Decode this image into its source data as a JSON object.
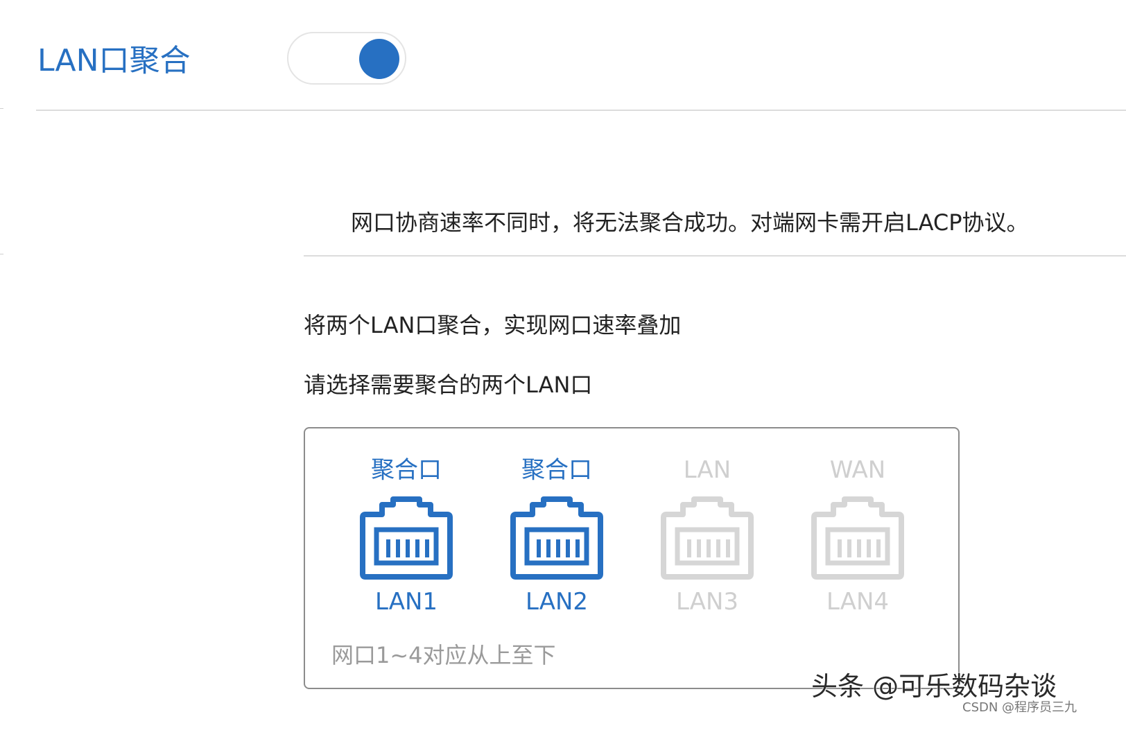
{
  "header": {
    "title": "LAN口聚合",
    "toggle_on": true
  },
  "notice": {
    "text": "网口协商速率不同时，将无法聚合成功。对端网卡需开启LACP协议。"
  },
  "aggregation": {
    "description": "将两个LAN口聚合，实现网口速率叠加",
    "prompt": "请选择需要聚合的两个LAN口",
    "ports": [
      {
        "top_label": "聚合口",
        "name": "LAN1",
        "selected": true
      },
      {
        "top_label": "聚合口",
        "name": "LAN2",
        "selected": true
      },
      {
        "top_label": "LAN",
        "name": "LAN3",
        "selected": false
      },
      {
        "top_label": "WAN",
        "name": "LAN4",
        "selected": false
      }
    ],
    "note": "网口1~4对应从上至下"
  },
  "colors": {
    "accent": "#2770c2",
    "inactive": "#d6d6d6",
    "inactive_text": "#cfcfcf"
  },
  "watermark": {
    "main": "头条 @可乐数码杂谈",
    "sub": "CSDN @程序员三九"
  }
}
